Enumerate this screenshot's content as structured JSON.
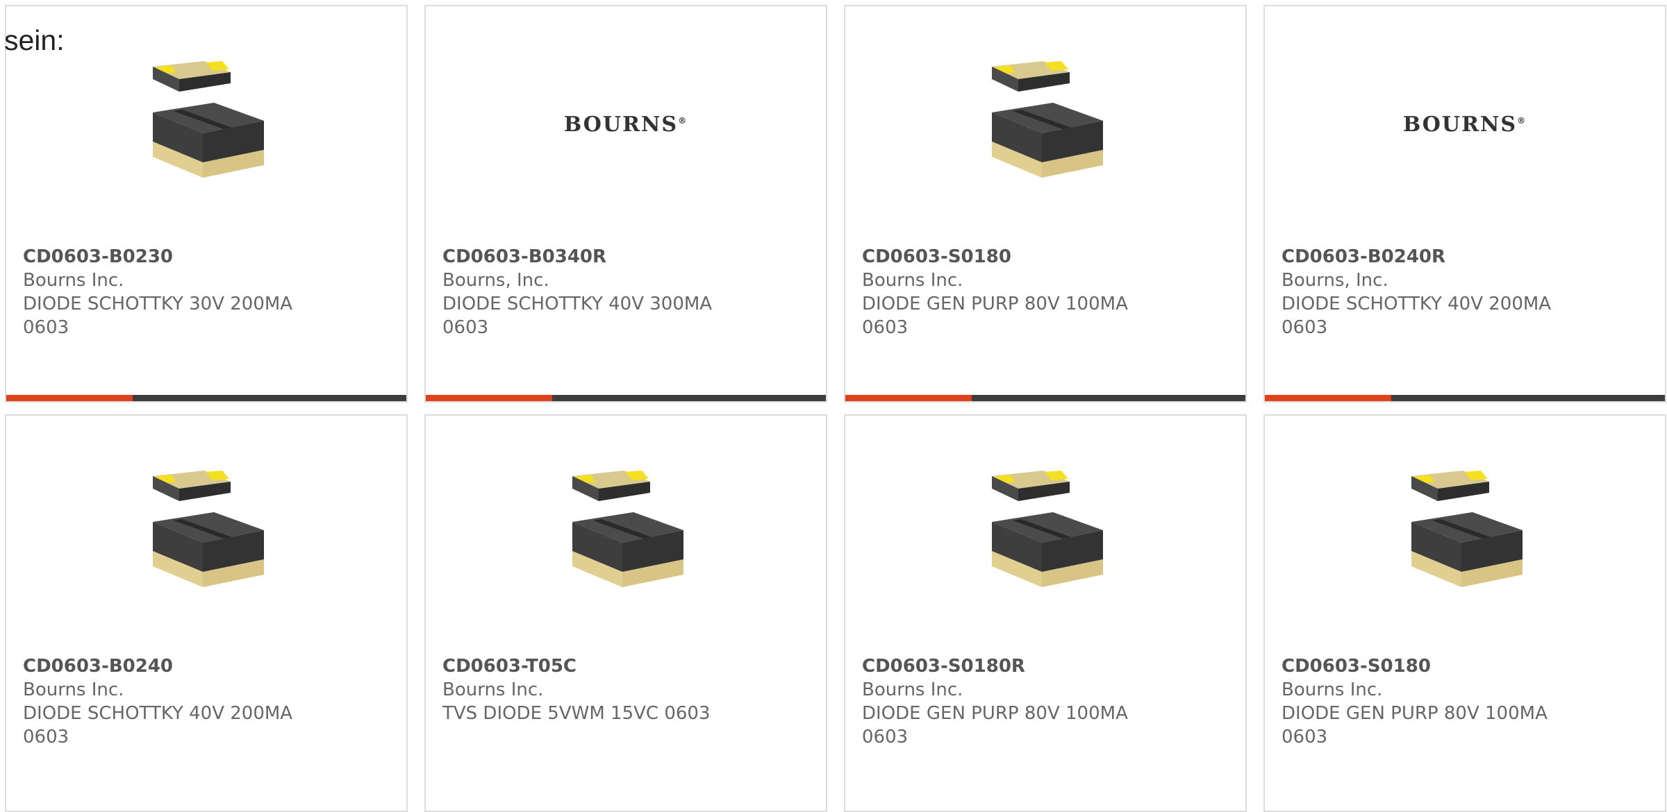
{
  "intro_text": "sein:",
  "colors": {
    "accent": "#e0401c",
    "bar": "#3d3d3d",
    "border": "#dcdcdc",
    "text": "#666666"
  },
  "products": [
    {
      "part_number": "CD0603-B0230",
      "manufacturer": "Bourns Inc.",
      "description": "DIODE SCHOTTKY 30V 200MA 0603",
      "image": "diode-chip-icon"
    },
    {
      "part_number": "CD0603-B0340R",
      "manufacturer": "Bourns, Inc.",
      "description": "DIODE SCHOTTKY 40V 300MA 0603",
      "image": "bourns-logo",
      "logo_text": "BOURNS"
    },
    {
      "part_number": "CD0603-S0180",
      "manufacturer": "Bourns Inc.",
      "description": "DIODE GEN PURP 80V 100MA 0603",
      "image": "diode-chip-icon"
    },
    {
      "part_number": "CD0603-B0240R",
      "manufacturer": "Bourns, Inc.",
      "description": "DIODE SCHOTTKY 40V 200MA 0603",
      "image": "bourns-logo",
      "logo_text": "BOURNS"
    },
    {
      "part_number": "CD0603-B0240",
      "manufacturer": "Bourns Inc.",
      "description": "DIODE SCHOTTKY 40V 200MA 0603",
      "image": "diode-chip-icon"
    },
    {
      "part_number": "CD0603-T05C",
      "manufacturer": "Bourns Inc.",
      "description": "TVS DIODE 5VWM 15VC 0603",
      "image": "diode-chip-icon"
    },
    {
      "part_number": "CD0603-S0180R",
      "manufacturer": "Bourns Inc.",
      "description": "DIODE GEN PURP 80V 100MA 0603",
      "image": "diode-chip-icon"
    },
    {
      "part_number": "CD0603-S0180",
      "manufacturer": "Bourns Inc.",
      "description": "DIODE GEN PURP 80V 100MA 0603",
      "image": "diode-chip-icon"
    }
  ]
}
